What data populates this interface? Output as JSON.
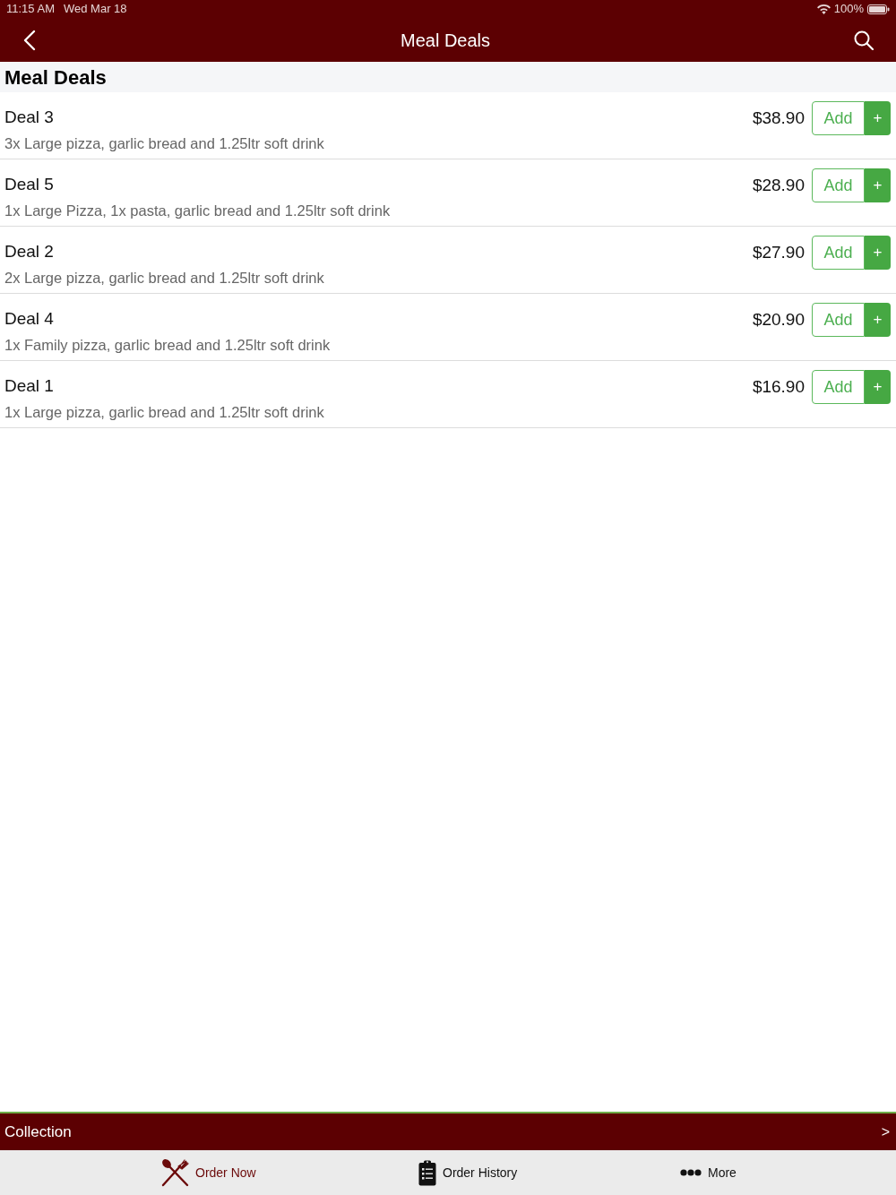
{
  "status_bar": {
    "time": "11:15 AM",
    "date": "Wed Mar 18",
    "battery": "100%"
  },
  "nav_bar": {
    "title": "Meal Deals"
  },
  "section": {
    "title": "Meal Deals"
  },
  "deals": [
    {
      "name": "Deal 3",
      "description": "3x Large pizza, garlic bread and 1.25ltr soft drink",
      "price": "$38.90",
      "button": "Add",
      "plus": "+"
    },
    {
      "name": "Deal 5",
      "description": "1x Large Pizza, 1x pasta, garlic bread and 1.25ltr soft drink",
      "price": "$28.90",
      "button": "Add",
      "plus": "+"
    },
    {
      "name": "Deal 2",
      "description": "2x Large pizza, garlic bread and 1.25ltr soft drink",
      "price": "$27.90",
      "button": "Add",
      "plus": "+"
    },
    {
      "name": "Deal 4",
      "description": "1x Family pizza, garlic bread and 1.25ltr soft drink",
      "price": "$20.90",
      "button": "Add",
      "plus": "+"
    },
    {
      "name": "Deal 1",
      "description": "1x Large pizza, garlic bread and 1.25ltr soft drink",
      "price": "$16.90",
      "button": "Add",
      "plus": "+"
    }
  ],
  "collection_bar": {
    "label": "Collection",
    "arrow": ">"
  },
  "tab_bar": [
    {
      "label": "Order Now",
      "kind": "utensils",
      "selected": true
    },
    {
      "label": "Order History",
      "kind": "clipboard",
      "selected": false
    },
    {
      "label": "More",
      "kind": "dots",
      "selected": false
    }
  ]
}
